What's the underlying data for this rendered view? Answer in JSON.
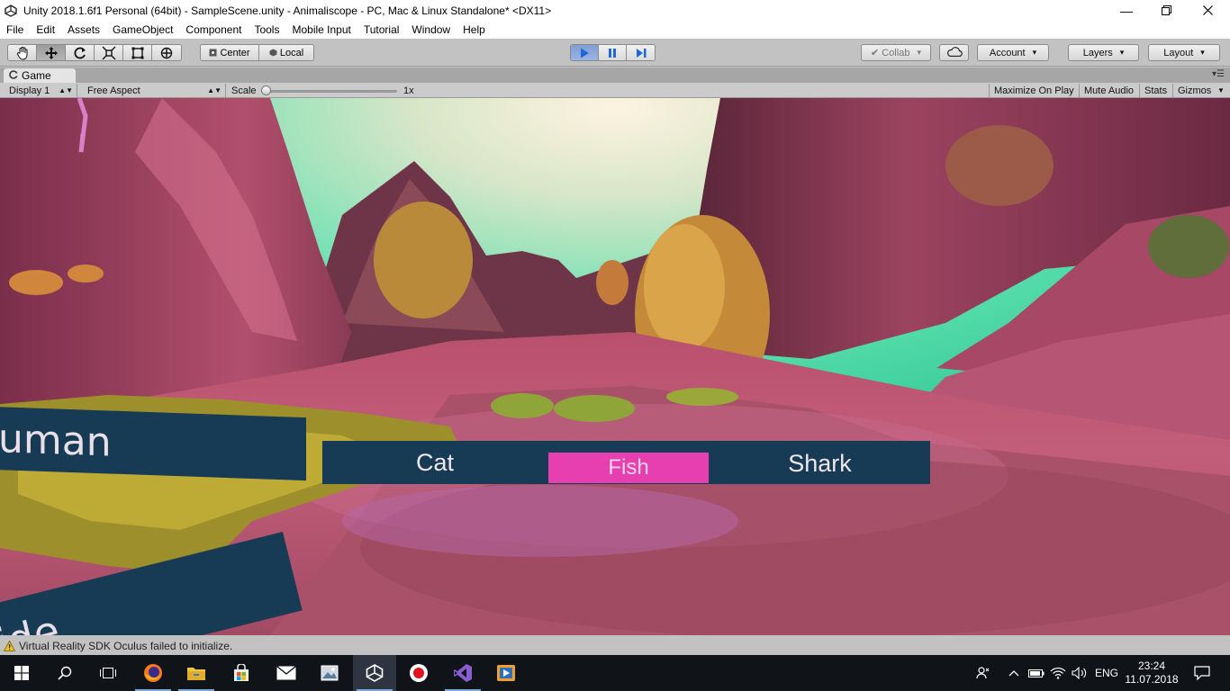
{
  "window": {
    "title": "Unity 2018.1.6f1 Personal (64bit) - SampleScene.unity - Animaliscope - PC, Mac & Linux Standalone* <DX11>",
    "controls": [
      "minimize-icon",
      "restore-icon",
      "close-icon"
    ]
  },
  "menu": [
    "File",
    "Edit",
    "Assets",
    "GameObject",
    "Component",
    "Tools",
    "Mobile Input",
    "Tutorial",
    "Window",
    "Help"
  ],
  "toolbar": {
    "tools": [
      "hand-tool-icon",
      "move-tool-icon",
      "rotate-tool-icon",
      "scale-tool-icon",
      "rect-tool-icon",
      "transform-tool-icon"
    ],
    "pivot_mode": "Center",
    "pivot_space": "Local",
    "play_controls": [
      "play-icon",
      "pause-icon",
      "step-icon"
    ],
    "collab": "Collab",
    "account": "Account",
    "layers": "Layers",
    "layout": "Layout"
  },
  "game_panel": {
    "tab_label": "Game",
    "display": "Display 1",
    "aspect": "Free Aspect",
    "scale_label": "Scale",
    "scale_value": "1x",
    "buttons": [
      "Maximize On Play",
      "Mute Audio",
      "Stats",
      "Gizmos"
    ]
  },
  "vr_menu": {
    "human": "uman",
    "guide": "ide",
    "cat": "Cat",
    "fish": "Fish",
    "shark": "Shark",
    "selected": "Fish",
    "colors": {
      "panel": "#173b55",
      "highlight": "#e83fb0"
    }
  },
  "status": {
    "message": "Virtual Reality SDK Oculus failed to initialize."
  },
  "taskbar": {
    "apps": [
      "windows-start-icon",
      "search-icon",
      "task-view-icon",
      "firefox-icon",
      "file-explorer-icon",
      "store-icon",
      "mail-icon",
      "photos-icon",
      "unity-icon",
      "record-icon",
      "visual-studio-icon",
      "media-player-icon"
    ],
    "language": "ENG",
    "time": "23:24",
    "date": "11.07.2018"
  }
}
